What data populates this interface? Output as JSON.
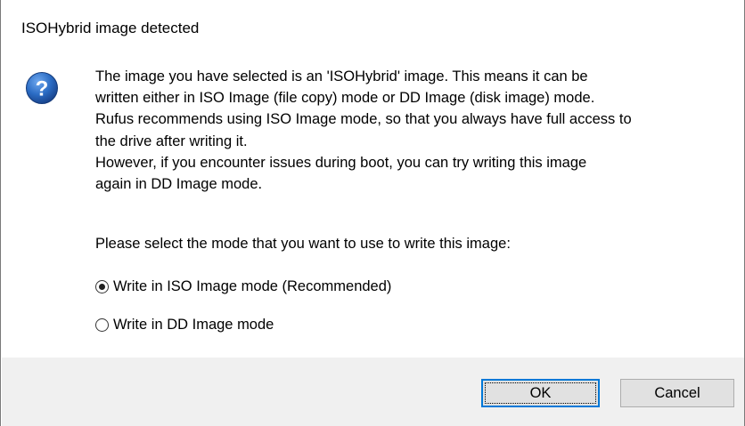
{
  "dialog": {
    "title": "ISOHybrid image detected",
    "icon": "question-icon",
    "message_lines": [
      "The image you have selected is an 'ISOHybrid' image. This means it can be",
      "written either in ISO Image (file copy) mode or DD Image (disk image) mode.",
      "Rufus recommends using ISO Image mode, so that you always have full access to",
      "the drive after writing it.",
      "However, if you encounter issues during boot, you can try writing this image",
      "again in DD Image mode."
    ],
    "prompt": "Please select the mode that you want to use to write this image:",
    "options": [
      {
        "label": "Write in ISO Image mode (Recommended)",
        "selected": true
      },
      {
        "label": "Write in DD Image mode",
        "selected": false
      }
    ],
    "buttons": {
      "ok_label": "OK",
      "cancel_label": "Cancel"
    },
    "colors": {
      "icon_blue": "#1e5aa8",
      "focus_border": "#0078d7",
      "footer_bg": "#f0f0f0"
    }
  }
}
